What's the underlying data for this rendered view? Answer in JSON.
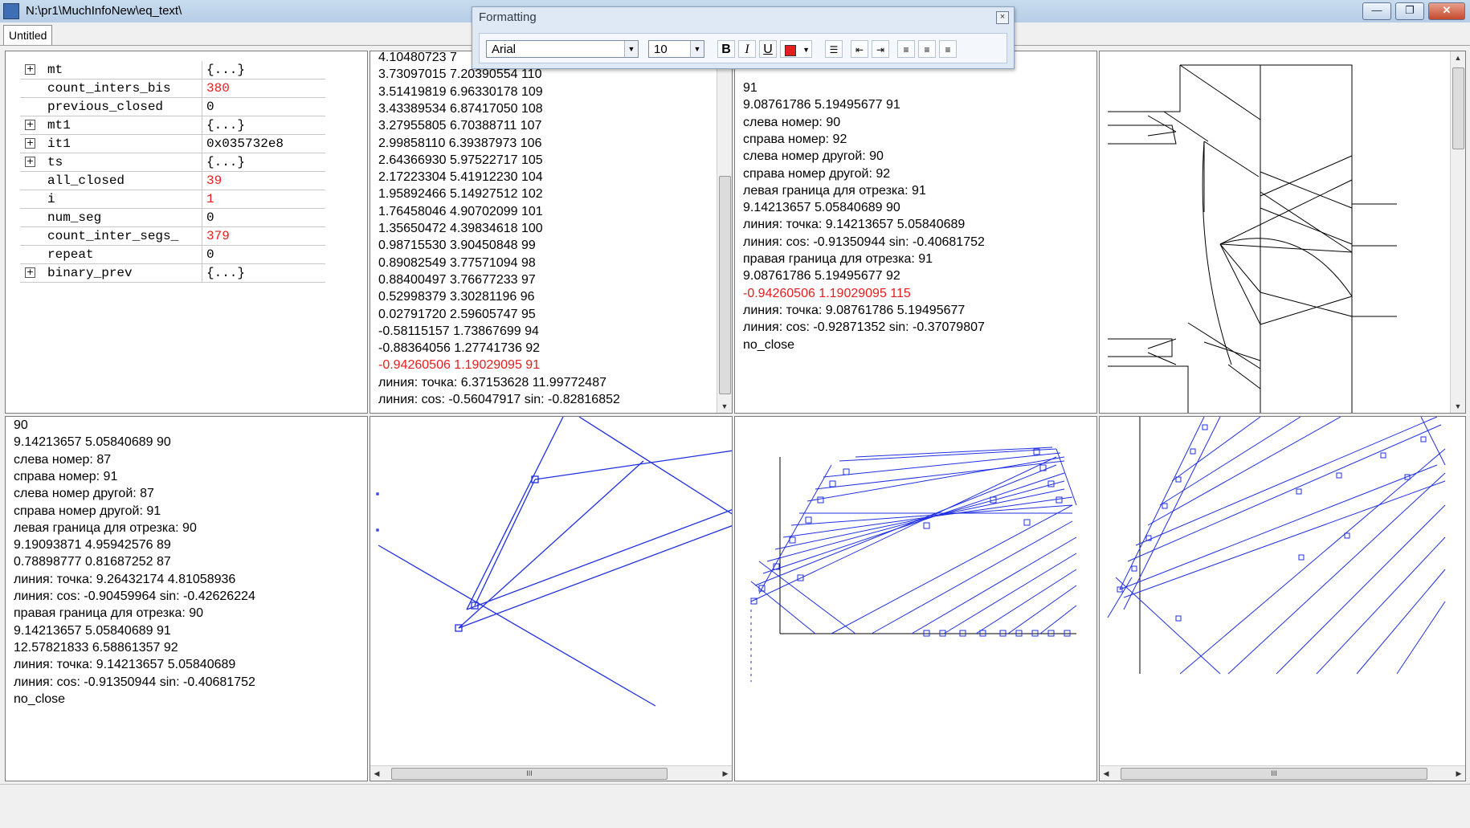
{
  "window": {
    "title": "N:\\pr1\\MuchInfoNew\\eq_text\\",
    "minimize_label": "—",
    "restore_label": "❐",
    "close_label": "✕"
  },
  "tabs": [
    {
      "label": "Untitled"
    }
  ],
  "formatting": {
    "title": "Formatting",
    "close_label": "×",
    "font": "Arial",
    "size": "10",
    "bold_label": "B",
    "italic_label": "I",
    "underline_label": "U",
    "text_color": "#e41e1e",
    "icons": [
      "bold-icon",
      "italic-icon",
      "underline-icon",
      "font-color-icon",
      "bullet-list-icon",
      "decrease-indent-icon",
      "increase-indent-icon",
      "align-left-icon",
      "align-center-icon",
      "align-right-icon"
    ]
  },
  "watch": {
    "rows": [
      {
        "expand": "+",
        "name": "mt",
        "value": "{...}",
        "highlight": false
      },
      {
        "expand": "",
        "name": "count_inters_bis",
        "value": "380",
        "highlight": true
      },
      {
        "expand": "",
        "name": "previous_closed",
        "value": "0",
        "highlight": false
      },
      {
        "expand": "+",
        "name": "mt1",
        "value": "{...}",
        "highlight": false
      },
      {
        "expand": "+",
        "name": "it1",
        "value": "0x035732e8",
        "highlight": false
      },
      {
        "expand": "+",
        "name": "ts",
        "value": "{...}",
        "highlight": false
      },
      {
        "expand": "",
        "name": "all_closed",
        "value": "39",
        "highlight": true
      },
      {
        "expand": "",
        "name": "i",
        "value": "1",
        "highlight": true
      },
      {
        "expand": "",
        "name": "num_seg",
        "value": "0",
        "highlight": false
      },
      {
        "expand": "",
        "name": "count_inter_segs_",
        "value": "379",
        "highlight": true
      },
      {
        "expand": "",
        "name": "repeat",
        "value": "0",
        "highlight": false
      },
      {
        "expand": "+",
        "name": "binary_prev",
        "value": "{...}",
        "highlight": false
      }
    ]
  },
  "coords_list": {
    "lines": [
      "4.10480723  7",
      "3.73097015  7.20390554  110",
      "3.51419819  6.96330178  109",
      "3.43389534  6.87417050  108",
      "3.27955805  6.70388711  107",
      "2.99858110  6.39387973  106",
      "2.64366930  5.97522717  105",
      "2.17223304  5.41912230  104",
      "1.95892466  5.14927512  102",
      "1.76458046  4.90702099  101",
      "1.35650472  4.39834618  100",
      "0.98715530  3.90450848  99",
      "0.89082549  3.77571094  98",
      "0.88400497  3.76677233  97",
      "0.52998379  3.30281196  96",
      "0.02791720  2.59605747  95",
      "-0.58115157  1.73867699  94",
      "-0.88364056  1.27741736  92",
      "-0.94260506  1.19029095  91",
      "линия: точка: 6.37153628  11.99772487",
      "линия: cos: -0.56047917    sin: -0.82816852"
    ],
    "highlight_index": 18
  },
  "info_top": {
    "lines": [
      " 91",
      "9.08761786  5.19495677  91",
      "слева номер:  90",
      "справа номер:  92",
      "   слева номер другой:  90",
      "   справа номер другой:  92",
      "левая граница для отрезка:  91",
      "9.14213657  5.05840689  90",
      "линия: точка: 9.14213657  5.05840689",
      "линия: cos: -0.91350944    sin: -0.40681752",
      "правая граница для отрезка:  91",
      "9.08761786  5.19495677  92",
      "-0.94260506  1.19029095  115",
      "линия: точка: 9.08761786  5.19495677",
      "линия: cos: -0.92871352    sin: -0.37079807",
      "   no_close"
    ],
    "highlight_index": 12
  },
  "info_bottom": {
    "lines": [
      "90",
      "9.14213657  5.05840689  90",
      "слева номер:  87",
      "справа номер:  91",
      "   слева номер другой:  87",
      "   справа номер другой:  91",
      "левая граница для отрезка:  90",
      "9.19093871  4.95942576  89",
      "0.78898777  0.81687252  87",
      "линия: точка: 9.26432174  4.81058936",
      "линия: cos: -0.90459964    sin: -0.42626224",
      "правая граница для отрезка:  90",
      "9.14213657  5.05840689  91",
      "12.57821833  6.58861357  92",
      "линия: точка: 9.14213657  5.05840689",
      "линия: cos: -0.91350944    sin: -0.40681752",
      "   no_close"
    ]
  },
  "colors": {
    "plot_blue": "#1f2fe0",
    "highlight_red": "#e41e1e"
  },
  "scroll": {
    "thumb_grip": "III"
  }
}
